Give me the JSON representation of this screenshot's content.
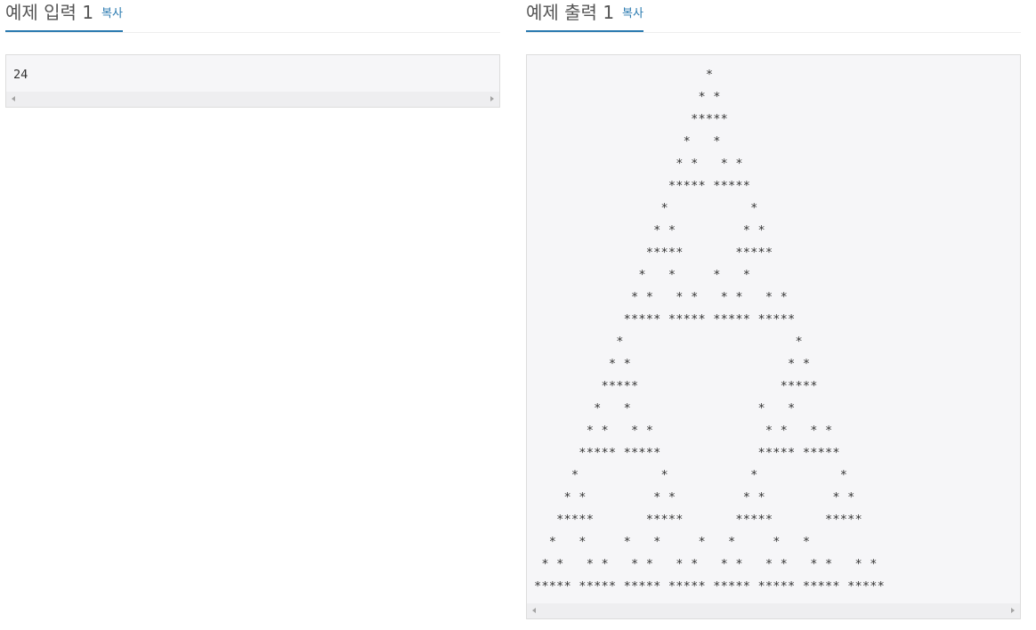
{
  "input_panel": {
    "title": "예제 입력 1",
    "copy_label": "복사",
    "content": "24"
  },
  "output_panel": {
    "title": "예제 출력 1",
    "copy_label": "복사",
    "content": "                       *                       \n                      * *                      \n                     *****                     \n                    *   *                    \n                   * *   * *                   \n                  ***** *****                  \n                 *           *                 \n                * *         * *                \n               *****       *****               \n              *   *     *   *              \n             * *   * *   * *   * *             \n            ***** ***** ***** *****            \n           *                       *           \n          * *                     * *          \n         *****                   *****         \n        *   *                 *   *        \n       * *   * *               * *   * *       \n      ***** *****             ***** *****      \n     *           *           *           *     \n    * *         * *         * *         * *    \n   *****       *****       *****       *****   \n  *   *     *   *     *   *     *   *  \n * *   * *   * *   * *   * *   * *   * *   * * \n***** ***** ***** ***** ***** ***** ***** *****"
  },
  "colors": {
    "accent": "#2a7ab0",
    "code_bg": "#f6f6f8",
    "border": "#dddddd"
  }
}
